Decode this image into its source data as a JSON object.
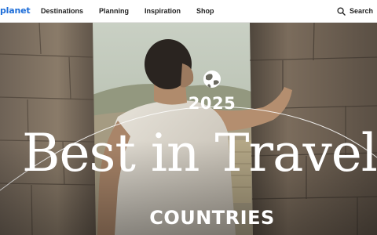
{
  "brand": {
    "logo_text": "planet",
    "accent": "#1d6dd8"
  },
  "nav": {
    "items": [
      {
        "label": "Destinations"
      },
      {
        "label": "Planning"
      },
      {
        "label": "Inspiration"
      },
      {
        "label": "Shop"
      }
    ],
    "search": {
      "label": "Search",
      "icon": "search-icon"
    }
  },
  "hero": {
    "year": "2025",
    "title": "Best in Travel",
    "subtitle": "COUNTRIES",
    "badge_icon": "globe-icon"
  }
}
